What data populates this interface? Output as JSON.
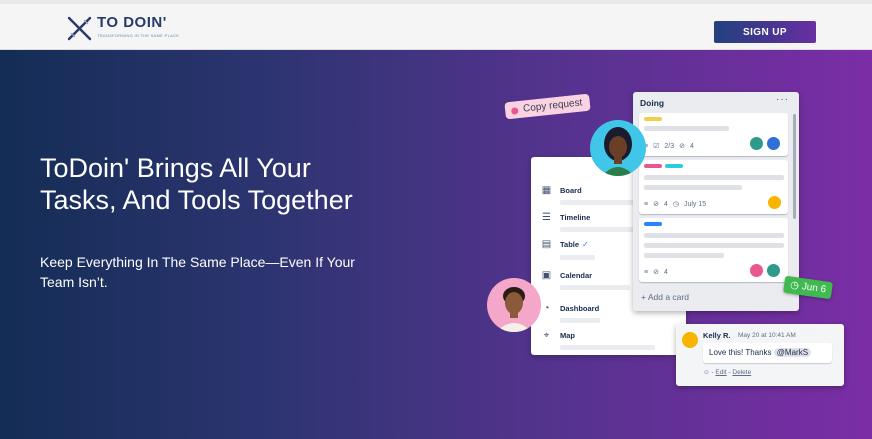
{
  "header": {
    "logo_name": "TO DOIN'",
    "logo_tagline": "TRANSFORMING IN THE SAME PLACE",
    "signup_label": "SIGN UP"
  },
  "hero": {
    "headline": "ToDoin' Brings All Your Tasks, And Tools Together",
    "subline": "Keep Everything In The Same Place—Even If Your Team Isn’t."
  },
  "illustration": {
    "copy_request": "Copy request",
    "menu": [
      {
        "label": "Board",
        "icon": "board-icon"
      },
      {
        "label": "Timeline",
        "icon": "timeline-icon"
      },
      {
        "label": "Table",
        "icon": "table-icon",
        "checked": true
      },
      {
        "label": "Calendar",
        "icon": "calendar-icon"
      },
      {
        "label": "Dashboard",
        "icon": "dashboard-icon"
      },
      {
        "label": "Map",
        "icon": "map-pin-icon"
      }
    ],
    "list": {
      "title": "Doing",
      "card1": {
        "checklist": "2/3",
        "attachments": "4"
      },
      "card2": {
        "attachments": "4",
        "due": "July 15"
      },
      "card3": {
        "attachments": "4"
      },
      "add_card": "Add a card"
    },
    "due_badge": "Jun 6",
    "comment": {
      "author": "Kelly R.",
      "time": "May 20 at 10:41 AM",
      "text": "Love this! Thanks",
      "mention": "@MarkS",
      "edit": "Edit",
      "delete": "Delete"
    }
  },
  "colors": {
    "hero_start": "#142d55",
    "hero_end": "#7b2da6",
    "signup_bg": "#3a3a8c",
    "label_yellow": "#f5cd47",
    "label_pink": "#e8578f",
    "label_teal": "#29cce5",
    "label_blue": "#2684ff",
    "due_green": "#3fb950"
  }
}
